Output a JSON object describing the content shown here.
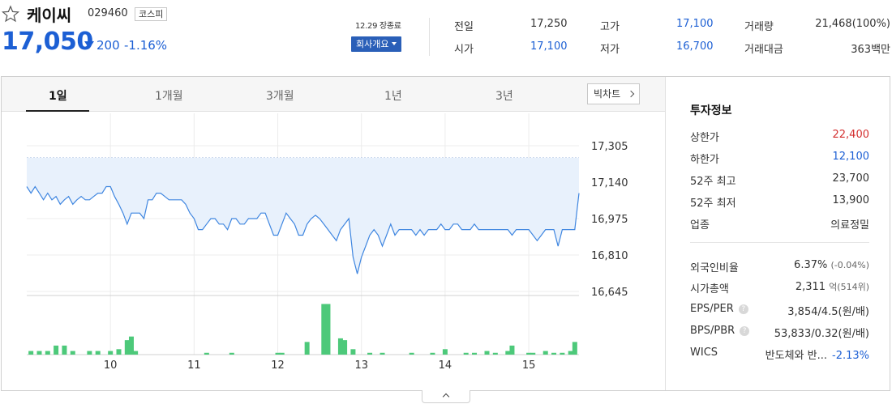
{
  "stock": {
    "name": "케이씨",
    "code": "029460",
    "market": "코스피",
    "price": "17,050",
    "change": "200",
    "change_pct": "-1.16%",
    "trade_date": "12.29 장종료",
    "company_button": "회사개요",
    "colors": {
      "down": "#1c5fd4",
      "up": "#d32f2f"
    }
  },
  "quotes": {
    "prev_label": "전일",
    "prev_value": "17,250",
    "high_label": "고가",
    "high_value": "17,100",
    "volume_label": "거래량",
    "volume_value": "21,468(100%)",
    "open_label": "시가",
    "open_value": "17,100",
    "low_label": "저가",
    "low_value": "16,700",
    "amount_label": "거래대금",
    "amount_value": "363백만"
  },
  "tabs": [
    "1일",
    "1개월",
    "3개월",
    "1년",
    "3년"
  ],
  "active_tab": 0,
  "big_chart_button": "빅차트",
  "info": {
    "title": "투자정보",
    "upper_limit_label": "상한가",
    "upper_limit": "22,400",
    "lower_limit_label": "하한가",
    "lower_limit": "12,100",
    "w52_high_label": "52주 최고",
    "w52_high": "23,700",
    "w52_low_label": "52주 최저",
    "w52_low": "13,900",
    "sector_label": "업종",
    "sector": "의료정밀",
    "foreign_label": "외국인비율",
    "foreign_value": "6.37%",
    "foreign_change": "(-0.04%)",
    "mcap_label": "시가총액",
    "mcap_value": "2,311",
    "mcap_unit": "억",
    "mcap_rank": "(514위)",
    "eps_per_label": "EPS/PER",
    "eps_per_value": "3,854/4.5",
    "eps_per_unit": "(원/배)",
    "bps_pbr_label": "BPS/PBR",
    "bps_pbr_value": "53,833/0.32",
    "bps_pbr_unit": "(원/배)",
    "wics_label": "WICS",
    "wics_value": "반도체와 반...",
    "wics_change": "-2.13%"
  },
  "chart_data": {
    "type": "area",
    "y_ticks": [
      "17,305",
      "17,140",
      "16,975",
      "16,810",
      "16,645"
    ],
    "x_ticks": [
      "10",
      "11",
      "12",
      "13",
      "14",
      "15"
    ],
    "ylim": [
      16645,
      17305
    ],
    "xlim": [
      9.0,
      15.6
    ],
    "prev_close": 17250,
    "series": [
      {
        "x": [
          9.0,
          9.05,
          9.1,
          9.15,
          9.2,
          9.25,
          9.3,
          9.35,
          9.4,
          9.45,
          9.5,
          9.55,
          9.6,
          9.65,
          9.7,
          9.75,
          9.8,
          9.85,
          9.9,
          9.95,
          10.0,
          10.05,
          10.1,
          10.15,
          10.2,
          10.25,
          10.3,
          10.35,
          10.4,
          10.45,
          10.5,
          10.55,
          10.6,
          10.65,
          10.7,
          10.75,
          10.8,
          10.85,
          10.9,
          10.95,
          11.0,
          11.05,
          11.1,
          11.15,
          11.2,
          11.25,
          11.3,
          11.35,
          11.4,
          11.45,
          11.5,
          11.55,
          11.6,
          11.65,
          11.7,
          11.75,
          11.8,
          11.85,
          11.9,
          11.95,
          12.0,
          12.05,
          12.1,
          12.15,
          12.2,
          12.25,
          12.3,
          12.35,
          12.4,
          12.45,
          12.5,
          12.55,
          12.6,
          12.65,
          12.7,
          12.75,
          12.8,
          12.85,
          12.9,
          12.95,
          13.0,
          13.05,
          13.1,
          13.15,
          13.2,
          13.25,
          13.3,
          13.35,
          13.4,
          13.45,
          13.5,
          13.55,
          13.6,
          13.65,
          13.7,
          13.75,
          13.8,
          13.85,
          13.9,
          13.95,
          14.0,
          14.05,
          14.1,
          14.15,
          14.2,
          14.25,
          14.3,
          14.35,
          14.4,
          14.45,
          14.5,
          14.55,
          14.6,
          14.65,
          14.7,
          14.75,
          14.8,
          14.85,
          14.9,
          14.95,
          15.0,
          15.05,
          15.1,
          15.15,
          15.2,
          15.25,
          15.3,
          15.35,
          15.4,
          15.45,
          15.5,
          15.55,
          15.6
        ],
        "y": [
          17120,
          17090,
          17120,
          17090,
          17060,
          17090,
          17060,
          17075,
          17040,
          17060,
          17075,
          17040,
          17060,
          17075,
          17060,
          17060,
          17075,
          17090,
          17090,
          17120,
          17120,
          17075,
          17040,
          17000,
          16950,
          17000,
          17000,
          17000,
          16975,
          17060,
          17060,
          17090,
          17090,
          17075,
          17060,
          17060,
          17060,
          17060,
          17040,
          17000,
          16975,
          16925,
          16925,
          16950,
          16975,
          16975,
          16950,
          16950,
          16925,
          16975,
          16975,
          16950,
          16950,
          16975,
          16975,
          16975,
          17000,
          17000,
          16950,
          16900,
          16900,
          16950,
          17000,
          16975,
          16950,
          16900,
          16900,
          16950,
          16975,
          16990,
          16975,
          16950,
          16925,
          16900,
          16875,
          16925,
          16950,
          16975,
          16800,
          16725,
          16800,
          16850,
          16900,
          16925,
          16900,
          16850,
          16900,
          16950,
          16900,
          16925,
          16925,
          16925,
          16925,
          16900,
          16925,
          16900,
          16925,
          16925,
          16925,
          16950,
          16925,
          16925,
          16950,
          16950,
          16925,
          16925,
          16925,
          16950,
          16925,
          16925,
          16925,
          16925,
          16925,
          16925,
          16925,
          16925,
          16900,
          16925,
          16925,
          16925,
          16925,
          16900,
          16875,
          16900,
          16925,
          16925,
          16925,
          16850,
          16925,
          16925,
          16925,
          16925,
          17090
        ]
      }
    ],
    "volume": {
      "x": [
        9.05,
        9.15,
        9.25,
        9.35,
        9.45,
        9.55,
        9.75,
        9.85,
        10.0,
        10.1,
        10.2,
        10.25,
        10.3,
        11.15,
        11.45,
        12.0,
        12.05,
        12.35,
        12.55,
        12.6,
        12.75,
        12.8,
        12.9,
        13.1,
        13.25,
        13.6,
        13.85,
        14.0,
        14.25,
        14.35,
        14.5,
        14.6,
        14.75,
        14.8,
        15.0,
        15.05,
        15.2,
        15.3,
        15.4,
        15.5,
        15.55
      ],
      "v": [
        2,
        2,
        2,
        5,
        5,
        2,
        2,
        2,
        2,
        3,
        8,
        10,
        2,
        1,
        1,
        1,
        1,
        7,
        28,
        28,
        9,
        8,
        3,
        1,
        1,
        1,
        1,
        3,
        1,
        1,
        2,
        1,
        2,
        5,
        1,
        1,
        2,
        1,
        1,
        2,
        7
      ],
      "max": 30
    }
  }
}
